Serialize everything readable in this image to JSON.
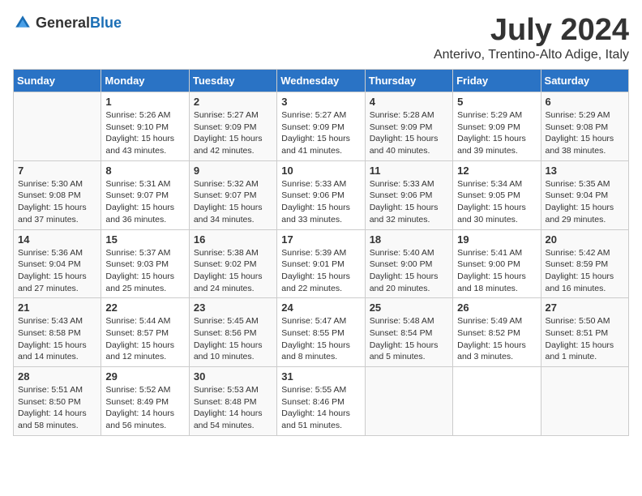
{
  "header": {
    "logo_general": "General",
    "logo_blue": "Blue",
    "month_year": "July 2024",
    "location": "Anterivo, Trentino-Alto Adige, Italy"
  },
  "days_of_week": [
    "Sunday",
    "Monday",
    "Tuesday",
    "Wednesday",
    "Thursday",
    "Friday",
    "Saturday"
  ],
  "weeks": [
    [
      {
        "day": "",
        "info": ""
      },
      {
        "day": "1",
        "info": "Sunrise: 5:26 AM\nSunset: 9:10 PM\nDaylight: 15 hours\nand 43 minutes."
      },
      {
        "day": "2",
        "info": "Sunrise: 5:27 AM\nSunset: 9:09 PM\nDaylight: 15 hours\nand 42 minutes."
      },
      {
        "day": "3",
        "info": "Sunrise: 5:27 AM\nSunset: 9:09 PM\nDaylight: 15 hours\nand 41 minutes."
      },
      {
        "day": "4",
        "info": "Sunrise: 5:28 AM\nSunset: 9:09 PM\nDaylight: 15 hours\nand 40 minutes."
      },
      {
        "day": "5",
        "info": "Sunrise: 5:29 AM\nSunset: 9:09 PM\nDaylight: 15 hours\nand 39 minutes."
      },
      {
        "day": "6",
        "info": "Sunrise: 5:29 AM\nSunset: 9:08 PM\nDaylight: 15 hours\nand 38 minutes."
      }
    ],
    [
      {
        "day": "7",
        "info": "Sunrise: 5:30 AM\nSunset: 9:08 PM\nDaylight: 15 hours\nand 37 minutes."
      },
      {
        "day": "8",
        "info": "Sunrise: 5:31 AM\nSunset: 9:07 PM\nDaylight: 15 hours\nand 36 minutes."
      },
      {
        "day": "9",
        "info": "Sunrise: 5:32 AM\nSunset: 9:07 PM\nDaylight: 15 hours\nand 34 minutes."
      },
      {
        "day": "10",
        "info": "Sunrise: 5:33 AM\nSunset: 9:06 PM\nDaylight: 15 hours\nand 33 minutes."
      },
      {
        "day": "11",
        "info": "Sunrise: 5:33 AM\nSunset: 9:06 PM\nDaylight: 15 hours\nand 32 minutes."
      },
      {
        "day": "12",
        "info": "Sunrise: 5:34 AM\nSunset: 9:05 PM\nDaylight: 15 hours\nand 30 minutes."
      },
      {
        "day": "13",
        "info": "Sunrise: 5:35 AM\nSunset: 9:04 PM\nDaylight: 15 hours\nand 29 minutes."
      }
    ],
    [
      {
        "day": "14",
        "info": "Sunrise: 5:36 AM\nSunset: 9:04 PM\nDaylight: 15 hours\nand 27 minutes."
      },
      {
        "day": "15",
        "info": "Sunrise: 5:37 AM\nSunset: 9:03 PM\nDaylight: 15 hours\nand 25 minutes."
      },
      {
        "day": "16",
        "info": "Sunrise: 5:38 AM\nSunset: 9:02 PM\nDaylight: 15 hours\nand 24 minutes."
      },
      {
        "day": "17",
        "info": "Sunrise: 5:39 AM\nSunset: 9:01 PM\nDaylight: 15 hours\nand 22 minutes."
      },
      {
        "day": "18",
        "info": "Sunrise: 5:40 AM\nSunset: 9:00 PM\nDaylight: 15 hours\nand 20 minutes."
      },
      {
        "day": "19",
        "info": "Sunrise: 5:41 AM\nSunset: 9:00 PM\nDaylight: 15 hours\nand 18 minutes."
      },
      {
        "day": "20",
        "info": "Sunrise: 5:42 AM\nSunset: 8:59 PM\nDaylight: 15 hours\nand 16 minutes."
      }
    ],
    [
      {
        "day": "21",
        "info": "Sunrise: 5:43 AM\nSunset: 8:58 PM\nDaylight: 15 hours\nand 14 minutes."
      },
      {
        "day": "22",
        "info": "Sunrise: 5:44 AM\nSunset: 8:57 PM\nDaylight: 15 hours\nand 12 minutes."
      },
      {
        "day": "23",
        "info": "Sunrise: 5:45 AM\nSunset: 8:56 PM\nDaylight: 15 hours\nand 10 minutes."
      },
      {
        "day": "24",
        "info": "Sunrise: 5:47 AM\nSunset: 8:55 PM\nDaylight: 15 hours\nand 8 minutes."
      },
      {
        "day": "25",
        "info": "Sunrise: 5:48 AM\nSunset: 8:54 PM\nDaylight: 15 hours\nand 5 minutes."
      },
      {
        "day": "26",
        "info": "Sunrise: 5:49 AM\nSunset: 8:52 PM\nDaylight: 15 hours\nand 3 minutes."
      },
      {
        "day": "27",
        "info": "Sunrise: 5:50 AM\nSunset: 8:51 PM\nDaylight: 15 hours\nand 1 minute."
      }
    ],
    [
      {
        "day": "28",
        "info": "Sunrise: 5:51 AM\nSunset: 8:50 PM\nDaylight: 14 hours\nand 58 minutes."
      },
      {
        "day": "29",
        "info": "Sunrise: 5:52 AM\nSunset: 8:49 PM\nDaylight: 14 hours\nand 56 minutes."
      },
      {
        "day": "30",
        "info": "Sunrise: 5:53 AM\nSunset: 8:48 PM\nDaylight: 14 hours\nand 54 minutes."
      },
      {
        "day": "31",
        "info": "Sunrise: 5:55 AM\nSunset: 8:46 PM\nDaylight: 14 hours\nand 51 minutes."
      },
      {
        "day": "",
        "info": ""
      },
      {
        "day": "",
        "info": ""
      },
      {
        "day": "",
        "info": ""
      }
    ]
  ]
}
